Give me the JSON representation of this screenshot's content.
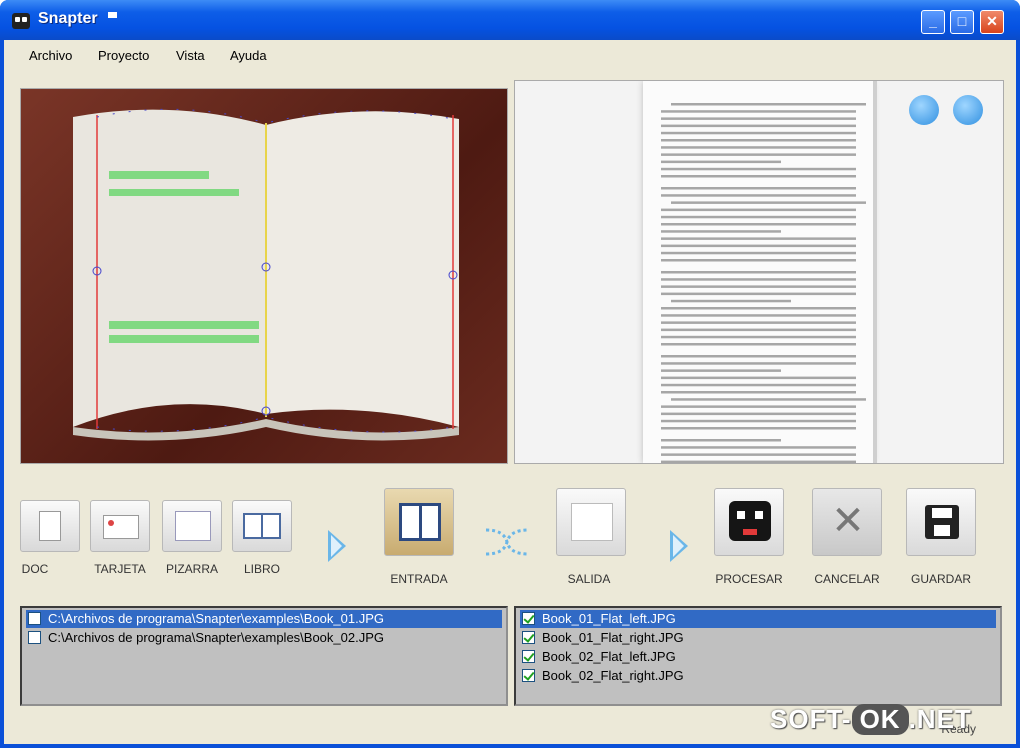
{
  "window": {
    "title": "Snapter"
  },
  "menu": [
    "Archivo",
    "Proyecto",
    "Vista",
    "Ayuda"
  ],
  "toolbar": {
    "doc_label": "DOC",
    "tarjeta_label": "TARJETA",
    "pizarra_label": "PIZARRA",
    "libro_label": "LIBRO",
    "entrada_label": "ENTRADA",
    "salida_label": "SALIDA",
    "procesar_label": "PROCESAR",
    "cancelar_label": "CANCELAR",
    "guardar_label": "GUARDAR"
  },
  "input_list": [
    {
      "path": "C:\\Archivos de programa\\Snapter\\examples\\Book_01.JPG",
      "checked": false,
      "selected": true
    },
    {
      "path": "C:\\Archivos de programa\\Snapter\\examples\\Book_02.JPG",
      "checked": false,
      "selected": false
    }
  ],
  "output_list": [
    {
      "name": "Book_01_Flat_left.JPG",
      "checked": true,
      "selected": true
    },
    {
      "name": "Book_01_Flat_right.JPG",
      "checked": true,
      "selected": false
    },
    {
      "name": "Book_02_Flat_left.JPG",
      "checked": true,
      "selected": false
    },
    {
      "name": "Book_02_Flat_right.JPG",
      "checked": true,
      "selected": false
    }
  ],
  "status": {
    "text": "Ready"
  },
  "watermark": {
    "left": "SOFT-",
    "middle": "OK",
    "right": ".NET"
  },
  "colors": {
    "titlebar": "#0552e2",
    "selection": "#316ac5",
    "arrow": "#6ab6e8"
  },
  "icons": {
    "rotate_left": "rotate-left-icon",
    "rotate_right": "rotate-right-icon"
  }
}
